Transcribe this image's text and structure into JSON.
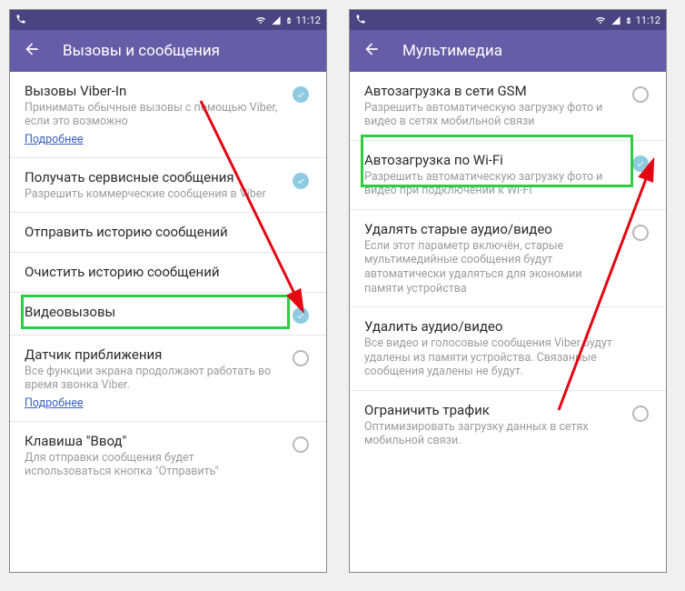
{
  "status_time": "11:12",
  "left": {
    "title": "Вызовы и сообщения",
    "items": [
      {
        "title": "Вызовы Viber-In",
        "sub": "Принимать обычные вызовы с помощью Viber, если это возможно",
        "link": "Подробнее",
        "control": "check"
      },
      {
        "title": "Получать сервисные сообщения",
        "sub": "Разрешить коммерческие сообщения в Viber",
        "control": "check"
      },
      {
        "title": "Отправить историю сообщений",
        "control": "none"
      },
      {
        "title": "Очистить историю сообщений",
        "control": "none"
      },
      {
        "title": "Видеовызовы",
        "control": "check"
      },
      {
        "title": "Датчик приближения",
        "sub": "Все функции экрана продолжают работать во время звонка Viber.",
        "link": "Подробнее",
        "control": "radio"
      },
      {
        "title": "Клавиша \"Ввод\"",
        "sub": "Для отправки сообщения будет использоваться кнопка \"Отправить\"",
        "control": "radio"
      }
    ]
  },
  "right": {
    "title": "Мультимедиа",
    "items": [
      {
        "title": "Автозагрузка в сети GSM",
        "sub": "Разрешить автоматическую загрузку фото и видео в сетях мобильной связи",
        "control": "radio"
      },
      {
        "title": "Автозагрузка по Wi-Fi",
        "sub": "Разрешить автоматическую загрузку фото и видео при подключении к Wi-Fi",
        "control": "check"
      },
      {
        "title": "Удалять старые аудио/видео",
        "sub": "Если этот параметр включён, старые мультимедийные сообщения будут автоматически удаляться для экономии памяти устройства",
        "control": "radio"
      },
      {
        "title": "Удалить аудио/видео",
        "sub": "Все видео и голосовые сообщения Viber будут удалены из памяти устройства. Связанные сообщения удалены не будут.",
        "control": "none"
      },
      {
        "title": "Ограничить трафик",
        "sub": "Оптимизировать загрузку данных в сетях мобильной связи.",
        "control": "radio"
      }
    ]
  }
}
